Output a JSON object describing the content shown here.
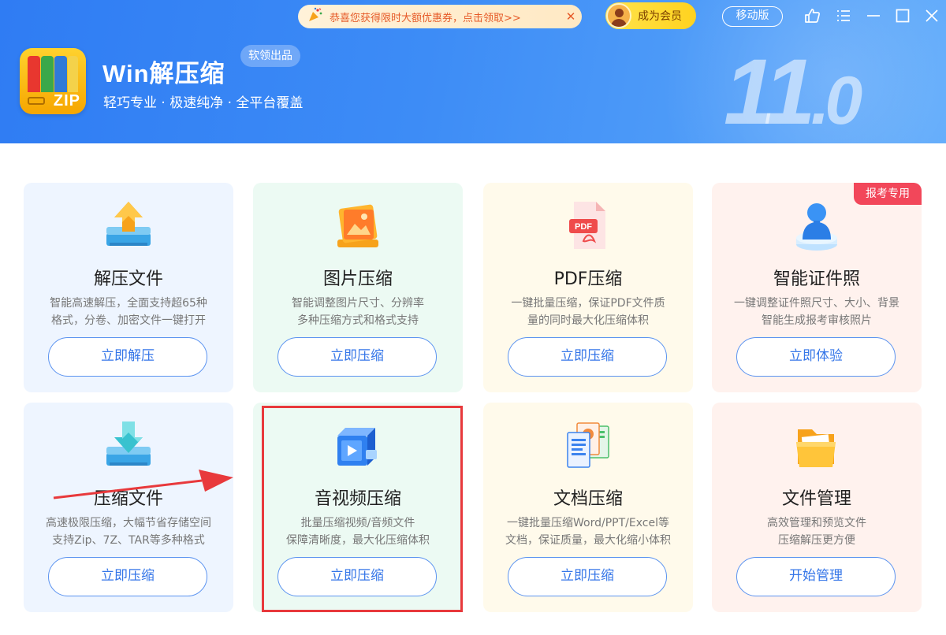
{
  "header": {
    "app_name": "Win解压缩",
    "vendor_badge": "软领出品",
    "tagline": "轻巧专业 · 极速纯净 · 全平台覆盖",
    "version_major": "11",
    "version_minor": "0",
    "logo_text": "ZIP",
    "promo_text": "恭喜您获得限时大额优惠券，点击领取>>",
    "vip_label": "成为会员",
    "mobile_label": "移动版"
  },
  "cards": [
    {
      "title": "解压文件",
      "desc1": "智能高速解压，全面支持超65种",
      "desc2": "格式，分卷、加密文件一键打开",
      "button": "立即解压"
    },
    {
      "title": "图片压缩",
      "desc1": "智能调整图片尺寸、分辨率",
      "desc2": "多种压缩方式和格式支持",
      "button": "立即压缩"
    },
    {
      "title": "PDF压缩",
      "desc1": "一键批量压缩，保证PDF文件质",
      "desc2": "量的同时最大化压缩体积",
      "button": "立即压缩",
      "icon_label": "PDF"
    },
    {
      "title": "智能证件照",
      "desc1": "一键调整证件照尺寸、大小、背景",
      "desc2": "智能生成报考审核照片",
      "button": "立即体验",
      "tag": "报考专用"
    },
    {
      "title": "压缩文件",
      "desc1": "高速极限压缩，大幅节省存储空间",
      "desc2": "支持Zip、7Z、TAR等多种格式",
      "button": "立即压缩"
    },
    {
      "title": "音视频压缩",
      "desc1": "批量压缩视频/音频文件",
      "desc2": "保障清晰度，最大化压缩体积",
      "button": "立即压缩"
    },
    {
      "title": "文档压缩",
      "desc1": "一键批量压缩Word/PPT/Excel等",
      "desc2": "文档，保证质量，最大化缩小体积",
      "button": "立即压缩"
    },
    {
      "title": "文件管理",
      "desc1": "高效管理和预览文件",
      "desc2": "压缩解压更方便",
      "button": "开始管理"
    }
  ],
  "colors": {
    "header_blue": "#2f7cf3",
    "button_text": "#3576e8",
    "highlight_red": "#e8393c",
    "tag_red": "#f2475a"
  }
}
